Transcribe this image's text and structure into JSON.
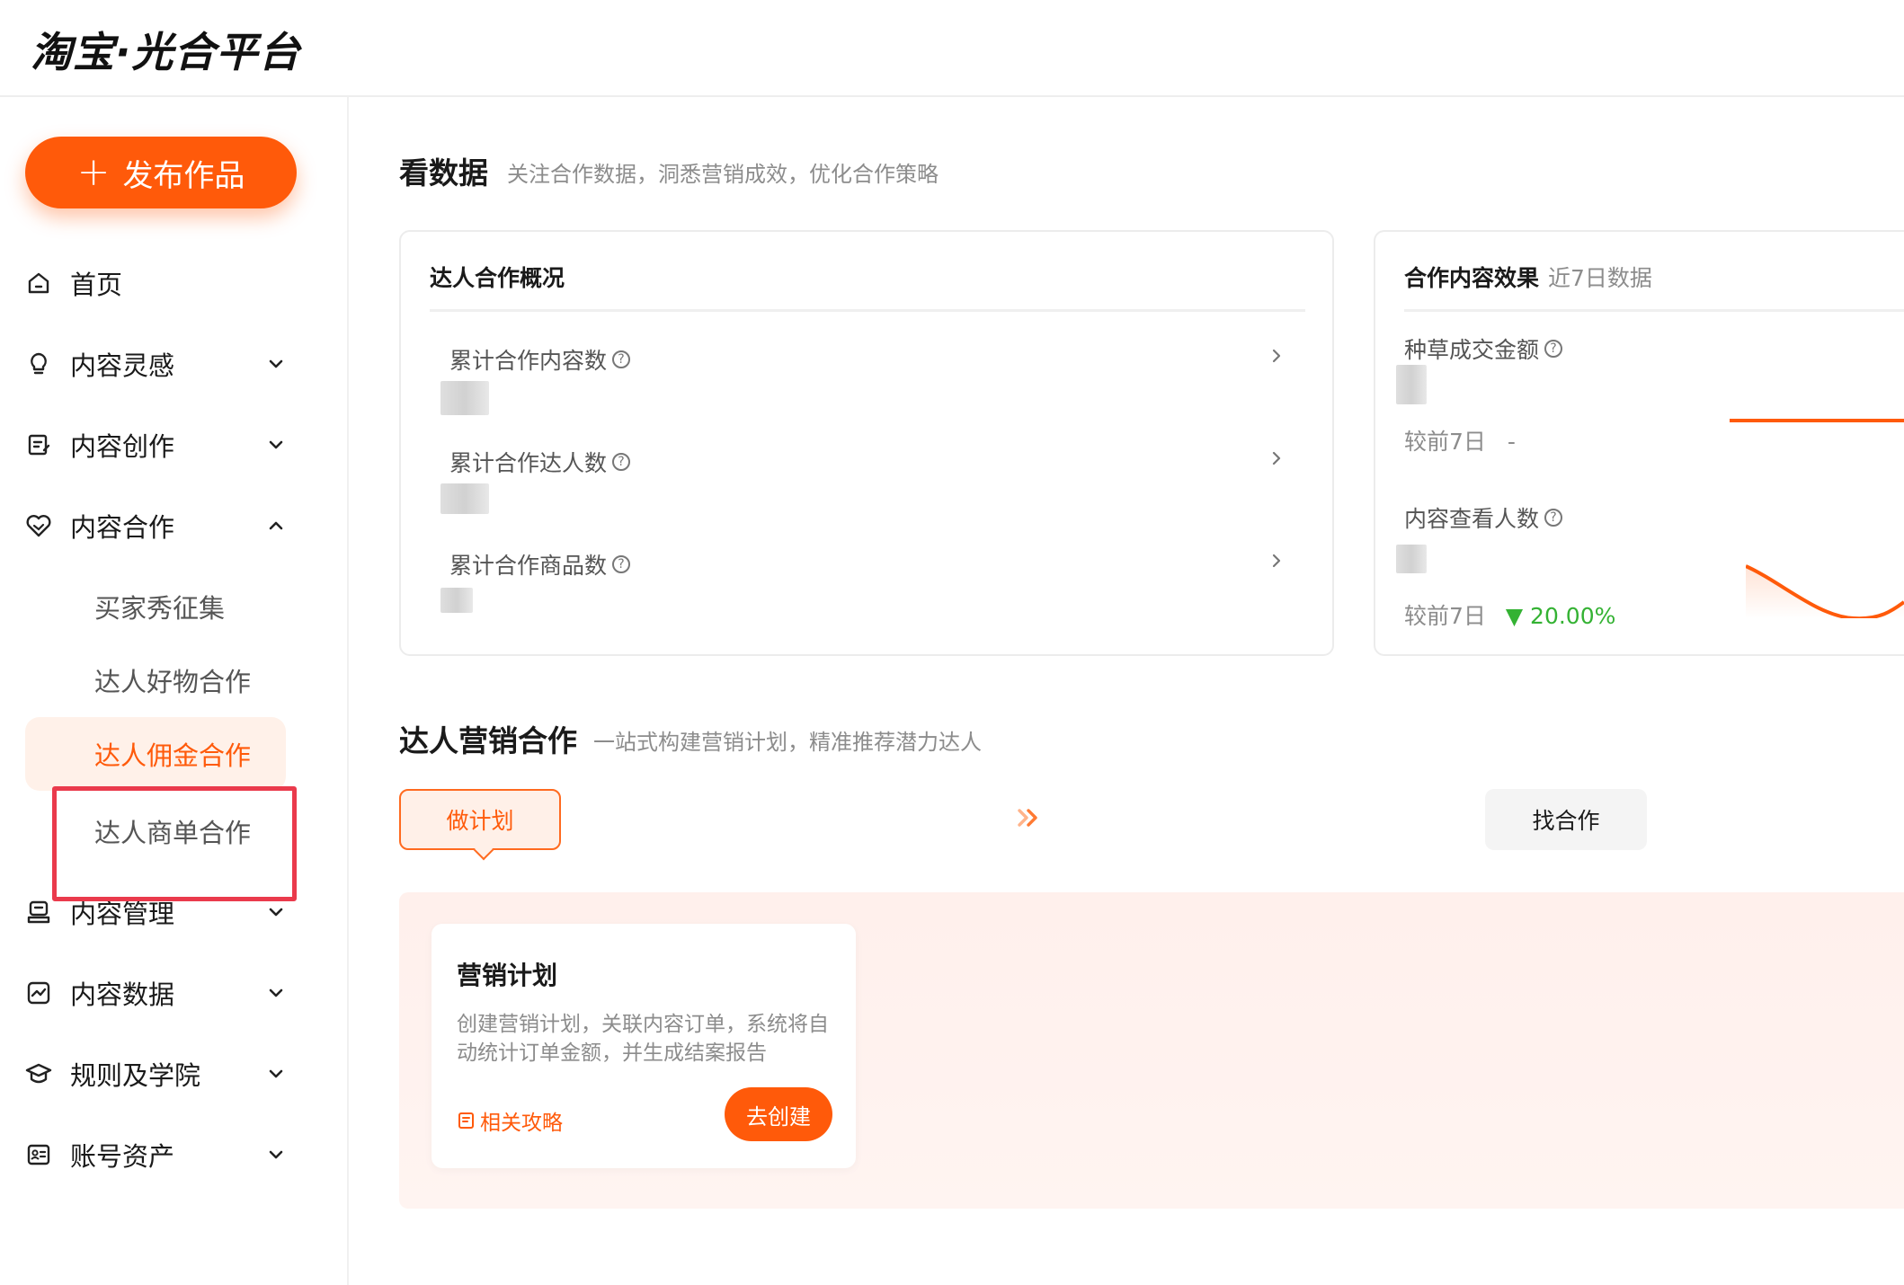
{
  "header": {
    "logo_text": "淘宝·光合平台"
  },
  "sidebar": {
    "publish_label": "发布作品",
    "items": [
      {
        "label": "首页",
        "icon": "home-icon"
      },
      {
        "label": "内容灵感",
        "icon": "bulb-icon"
      },
      {
        "label": "内容创作",
        "icon": "edit-icon"
      },
      {
        "label": "内容合作",
        "icon": "handshake-heart-icon"
      },
      {
        "label": "内容管理",
        "icon": "content-manage-icon"
      },
      {
        "label": "内容数据",
        "icon": "chart-icon"
      },
      {
        "label": "规则及学院",
        "icon": "graduation-cap-icon"
      },
      {
        "label": "账号资产",
        "icon": "id-card-icon"
      }
    ],
    "sub_items": [
      "买家秀征集",
      "达人好物合作",
      "达人佣金合作",
      "达人商单合作"
    ],
    "active_sub": "达人佣金合作"
  },
  "data_section": {
    "title": "看数据",
    "subtitle": "关注合作数据，洞悉营销成效，优化合作策略",
    "overview": {
      "title": "达人合作概况",
      "metrics": [
        "累计合作内容数",
        "累计合作达人数",
        "累计合作商品数"
      ]
    },
    "effect": {
      "title": "合作内容效果",
      "range": "近7日数据",
      "metrics": [
        {
          "label": "种草成交金额",
          "compare_label": "较前7日",
          "compare_value": "-"
        },
        {
          "label": "内容查看人数",
          "compare_label": "较前7日",
          "compare_value": "▼ 20.00%"
        }
      ]
    }
  },
  "marketing_section": {
    "title": "达人营销合作",
    "subtitle": "一站式构建营销计划，精准推荐潜力达人",
    "step_plan": "做计划",
    "step_find": "找合作",
    "plan_card": {
      "title": "营销计划",
      "desc": "创建营销计划，关联内容订单，系统将自动统计订单金额，并生成结案报告",
      "link": "相关攻略",
      "button": "去创建"
    }
  },
  "colors": {
    "accent": "#ff5a0a",
    "highlight_box": "#ea3a4c",
    "positive": "#34b233"
  }
}
